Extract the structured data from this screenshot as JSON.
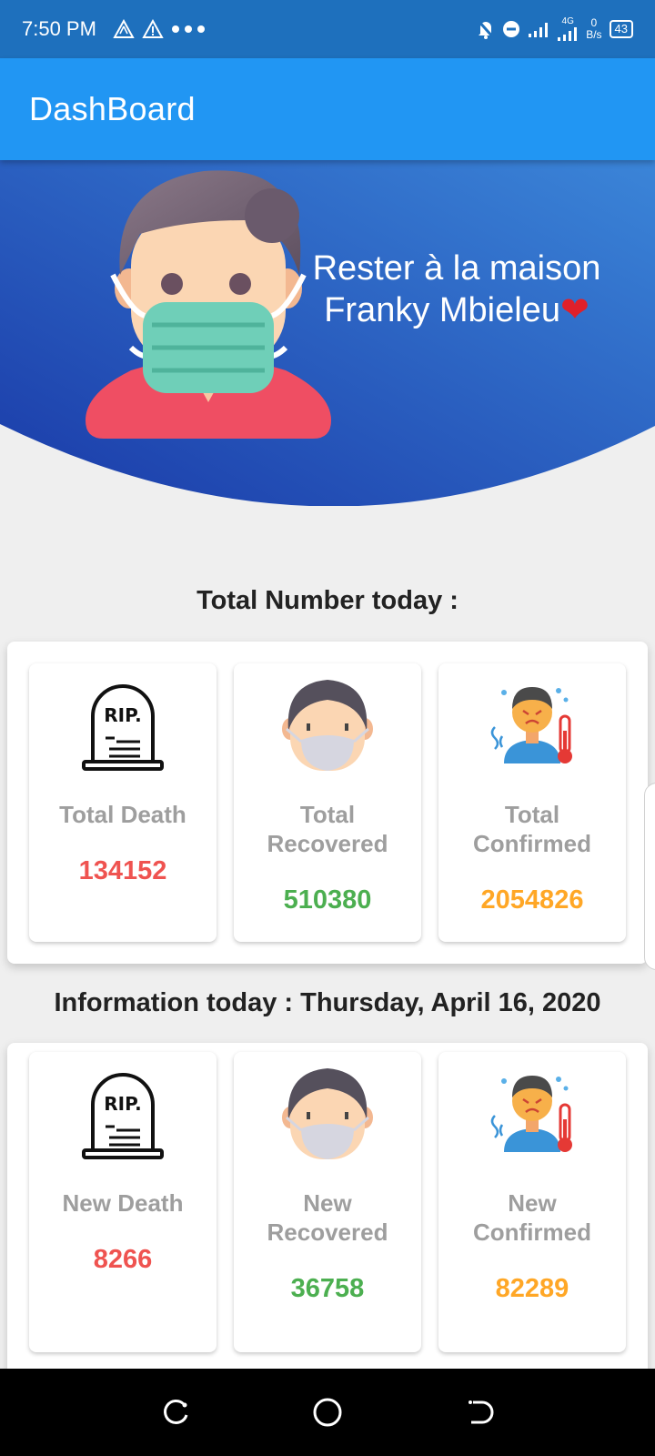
{
  "status_bar": {
    "time": "7:50 PM",
    "left_icons": [
      "alert-outline-icon",
      "warning-icon",
      "more-dots-icon"
    ],
    "right_icons": [
      "bell-off-icon",
      "do-not-disturb-icon",
      "signal-icon",
      "signal-4g-icon"
    ],
    "network_label": "4G",
    "data_speed": "0\nB/s",
    "battery": "43"
  },
  "app_bar": {
    "title": "DashBoard"
  },
  "banner": {
    "line1": "Rester à la maison",
    "line2": "Franky Mbieleu",
    "heart": "❤"
  },
  "totals": {
    "title": "Total Number today :",
    "cards": [
      {
        "label": "Total Death",
        "value": "134152",
        "icon": "rip-tombstone-icon"
      },
      {
        "label": "Total Recovered",
        "value": "510380",
        "icon": "masked-face-icon"
      },
      {
        "label": "Total Confirmed",
        "value": "2054826",
        "icon": "fever-person-icon"
      }
    ]
  },
  "today": {
    "title": "Information today : Thursday, April 16, 2020",
    "cards": [
      {
        "label": "New Death",
        "value": "8266",
        "icon": "rip-tombstone-icon"
      },
      {
        "label": "New Recovered",
        "value": "36758",
        "icon": "masked-face-icon"
      },
      {
        "label": "New Confirmed",
        "value": "82289",
        "icon": "fever-person-icon"
      }
    ]
  },
  "colors": {
    "status_bar": "#1e70bd",
    "app_bar": "#2196f3",
    "death": "#ef5350",
    "recovered": "#4caf50",
    "confirmed": "#ffa726",
    "label": "#9e9e9e"
  },
  "nav_bar": {
    "buttons": [
      "recents-icon",
      "home-icon",
      "back-icon"
    ]
  }
}
